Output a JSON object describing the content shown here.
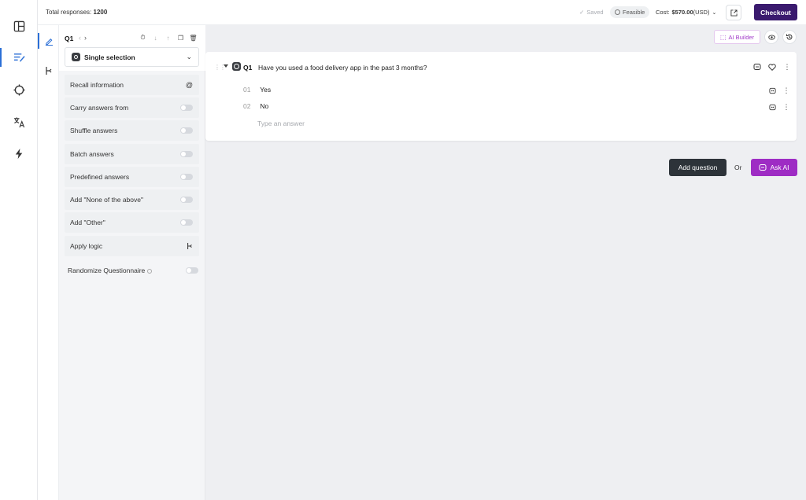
{
  "topbar": {
    "total_label": "Total responses:",
    "total_value": "1200",
    "saved": "Saved",
    "feasible": "Feasible",
    "cost_label": "Cost:",
    "cost_value": "$570.00",
    "cost_currency": "(USD)",
    "checkout": "Checkout"
  },
  "panel": {
    "question_label": "Q1",
    "question_type": "Single selection",
    "options": [
      {
        "label": "Recall information",
        "control": "at"
      },
      {
        "label": "Carry answers from",
        "control": "toggle"
      },
      {
        "label": "Shuffle answers",
        "control": "toggle"
      },
      {
        "label": "Batch answers",
        "control": "toggle"
      },
      {
        "label": "Predefined answers",
        "control": "toggle"
      },
      {
        "label": "Add \"None of the above\"",
        "control": "toggle"
      },
      {
        "label": "Add \"Other\"",
        "control": "toggle"
      },
      {
        "label": "Apply logic",
        "control": "logic"
      }
    ],
    "recall_symbol": "@",
    "randomize": "Randomize Questionnaire"
  },
  "main": {
    "ai_builder": "AI Builder",
    "question": {
      "number": "Q1",
      "text": "Have you used a food delivery app in the past 3 months?",
      "answers": [
        {
          "num": "01",
          "text": "Yes"
        },
        {
          "num": "02",
          "text": "No"
        }
      ],
      "answer_placeholder": "Type an answer"
    },
    "add_question": "Add question",
    "or": "Or",
    "ask_ai": "Ask AI"
  },
  "colors": {
    "accent_dark": "#3a1a6e",
    "ai_purple": "#9e2cc4",
    "active_blue": "#2b6fd6"
  }
}
